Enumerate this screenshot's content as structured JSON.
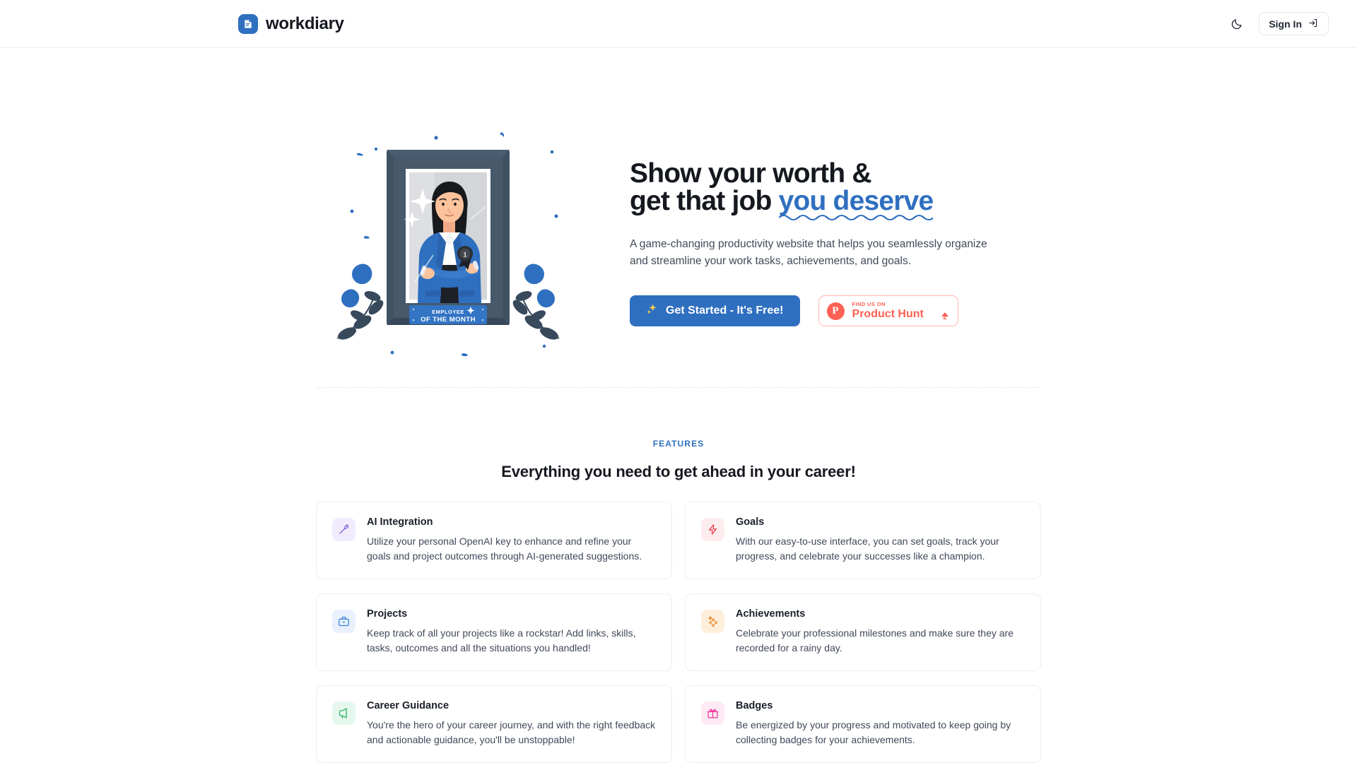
{
  "header": {
    "logo_icon": "note-document-icon",
    "brand_name": "workdiary",
    "theme_toggle_icon": "moon-icon",
    "signin_label": "Sign In",
    "signin_icon": "login-arrow-icon",
    "brand_color": "#2f6fc0"
  },
  "hero": {
    "illustration": {
      "name": "employee-of-the-month-frame-illustration",
      "plaque_line1": "EMPLOYEE",
      "plaque_line2": "OF THE MONTH",
      "medal_number": "1"
    },
    "headline_line1": "Show your worth &",
    "headline_line2_plain": "get that job ",
    "headline_line2_accent": "you deserve",
    "accent_color": "#2f6fc0",
    "subtitle": "A game-changing productivity website that helps you seamlessly organize and streamline your work tasks, achievements, and goals.",
    "primary_cta": {
      "label": "Get Started - It's Free!",
      "icon": "sparkles-icon",
      "bg": "#2f6fc0"
    },
    "product_hunt": {
      "kicker": "FIND US ON",
      "name": "Product Hunt",
      "logo_letter": "P",
      "vote_count": "2",
      "color": "#ff6154"
    }
  },
  "features": {
    "kicker": "FEATURES",
    "title": "Everything you need to get ahead in your career!",
    "cards": [
      {
        "title": "AI Integration",
        "desc": "Utilize your personal OpenAI key to enhance and refine your goals and project outcomes through AI-generated suggestions.",
        "icon": "magic-wand-icon",
        "icon_color": "#7c5cd6",
        "icon_bg": "#f1ecfd"
      },
      {
        "title": "Goals",
        "desc": "With our easy-to-use interface, you can set goals, track your progress, and celebrate your successes like a champion.",
        "icon": "lightning-bolt-icon",
        "icon_color": "#f04452",
        "icon_bg": "#fdecee"
      },
      {
        "title": "Projects",
        "desc": "Keep track of all your projects like a rockstar! Add links, skills, tasks, outcomes and all the situations you handled!",
        "icon": "briefcase-icon",
        "icon_color": "#3b82d6",
        "icon_bg": "#e8f1fc"
      },
      {
        "title": "Achievements",
        "desc": "Celebrate your professional milestones and make sure they are recorded for a rainy day.",
        "icon": "sparkle-star-icon",
        "icon_color": "#e8821e",
        "icon_bg": "#fdefdb"
      },
      {
        "title": "Career Guidance",
        "desc": "You're the hero of your career journey, and with the right feedback and actionable guidance, you'll be unstoppable!",
        "icon": "megaphone-icon",
        "icon_color": "#2bb464",
        "icon_bg": "#e6f7ed"
      },
      {
        "title": "Badges",
        "desc": "Be energized by your progress and motivated to keep going by collecting badges for your achievements.",
        "icon": "gift-icon",
        "icon_color": "#f0369b",
        "icon_bg": "#fdeaf4"
      }
    ]
  }
}
